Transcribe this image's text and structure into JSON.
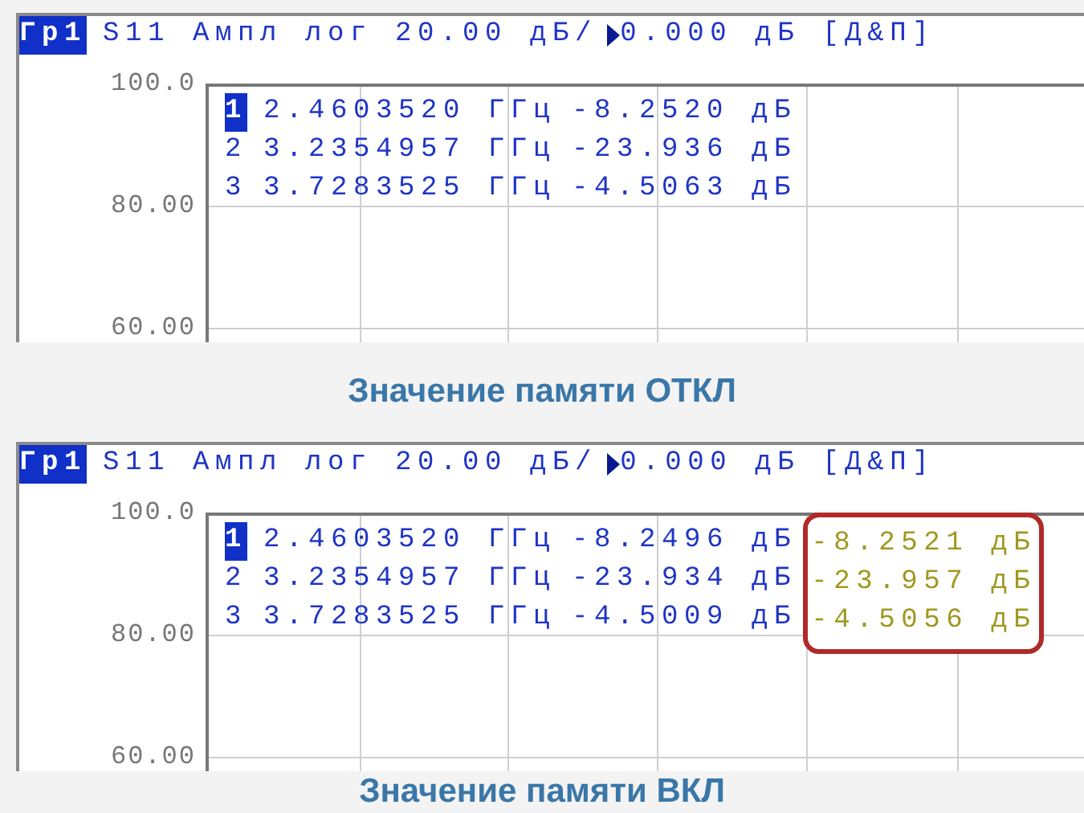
{
  "panels": [
    {
      "header": {
        "channel": "Гр1",
        "channel_selected": true,
        "scale": "S11 Ампл лог 20.00 дБ/",
        "reference": "0.000 дБ [Д&П]"
      },
      "y_labels": [
        "100.0",
        "80.00",
        "60.00"
      ],
      "markers": [
        {
          "number": "1",
          "selected": true,
          "frequency": "2.4603520 ГГц",
          "value": "-8.2520 дБ"
        },
        {
          "number": "2",
          "selected": false,
          "frequency": "3.2354957 ГГц",
          "value": "-23.936 дБ"
        },
        {
          "number": "3",
          "selected": false,
          "frequency": "3.7283525 ГГц",
          "value": "-4.5063 дБ"
        }
      ],
      "caption": "Значение памяти ОТКЛ"
    },
    {
      "header": {
        "channel": "Гр1",
        "channel_selected": true,
        "scale": "S11 Ампл лог 20.00 дБ/",
        "reference": "0.000 дБ [Д&П]"
      },
      "y_labels": [
        "100.0",
        "80.00",
        "60.00"
      ],
      "memory_highlighted": true,
      "markers": [
        {
          "number": "1",
          "selected": true,
          "frequency": "2.4603520 ГГц",
          "value": "-8.2496 дБ",
          "memory": "-8.2521 дБ"
        },
        {
          "number": "2",
          "selected": false,
          "frequency": "3.2354957 ГГц",
          "value": "-23.934 дБ",
          "memory": "-23.957 дБ"
        },
        {
          "number": "3",
          "selected": false,
          "frequency": "3.7283525 ГГц",
          "value": "-4.5009 дБ",
          "memory": "-4.5056 дБ"
        }
      ],
      "caption": "Значение памяти ВКЛ"
    }
  ]
}
